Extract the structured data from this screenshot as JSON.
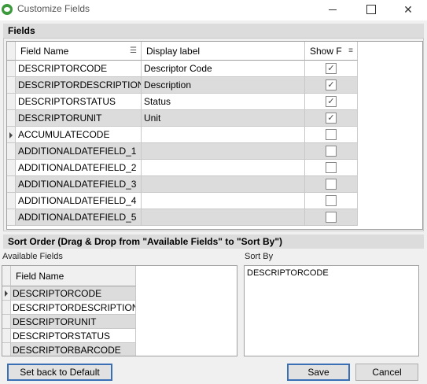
{
  "window": {
    "title": "Customize Fields",
    "icon": "app-icon"
  },
  "fields": {
    "group_label": "Fields",
    "columns": [
      "Field Name",
      "Display label",
      "Show F"
    ],
    "rows": [
      {
        "field": "DESCRIPTORCODE",
        "label": "Descriptor Code",
        "show": "✓"
      },
      {
        "field": "DESCRIPTORDESCRIPTION",
        "label": "Description",
        "show": "✓"
      },
      {
        "field": "DESCRIPTORSTATUS",
        "label": "Status",
        "show": "✓"
      },
      {
        "field": "DESCRIPTORUNIT",
        "label": "Unit",
        "show": "✓"
      },
      {
        "field": "ACCUMULATECODE",
        "label": "",
        "show": ""
      },
      {
        "field": "ADDITIONALDATEFIELD_1",
        "label": "",
        "show": ""
      },
      {
        "field": "ADDITIONALDATEFIELD_2",
        "label": "",
        "show": ""
      },
      {
        "field": "ADDITIONALDATEFIELD_3",
        "label": "",
        "show": ""
      },
      {
        "field": "ADDITIONALDATEFIELD_4",
        "label": "",
        "show": ""
      },
      {
        "field": "ADDITIONALDATEFIELD_5",
        "label": "",
        "show": ""
      }
    ]
  },
  "sort_order": {
    "group_label": "Sort Order (Drag & Drop from \"Available Fields\" to \"Sort By\")",
    "available_label": "Available Fields",
    "available_column": "Field Name",
    "available": [
      "DESCRIPTORCODE",
      "DESCRIPTORDESCRIPTION",
      "DESCRIPTORUNIT",
      "DESCRIPTORSTATUS",
      "DESCRIPTORBARCODE"
    ],
    "sort_by_label": "Sort By",
    "sort_by": [
      "DESCRIPTORCODE"
    ]
  },
  "buttons": {
    "default": "Set back to Default",
    "save": "Save",
    "cancel": "Cancel"
  }
}
